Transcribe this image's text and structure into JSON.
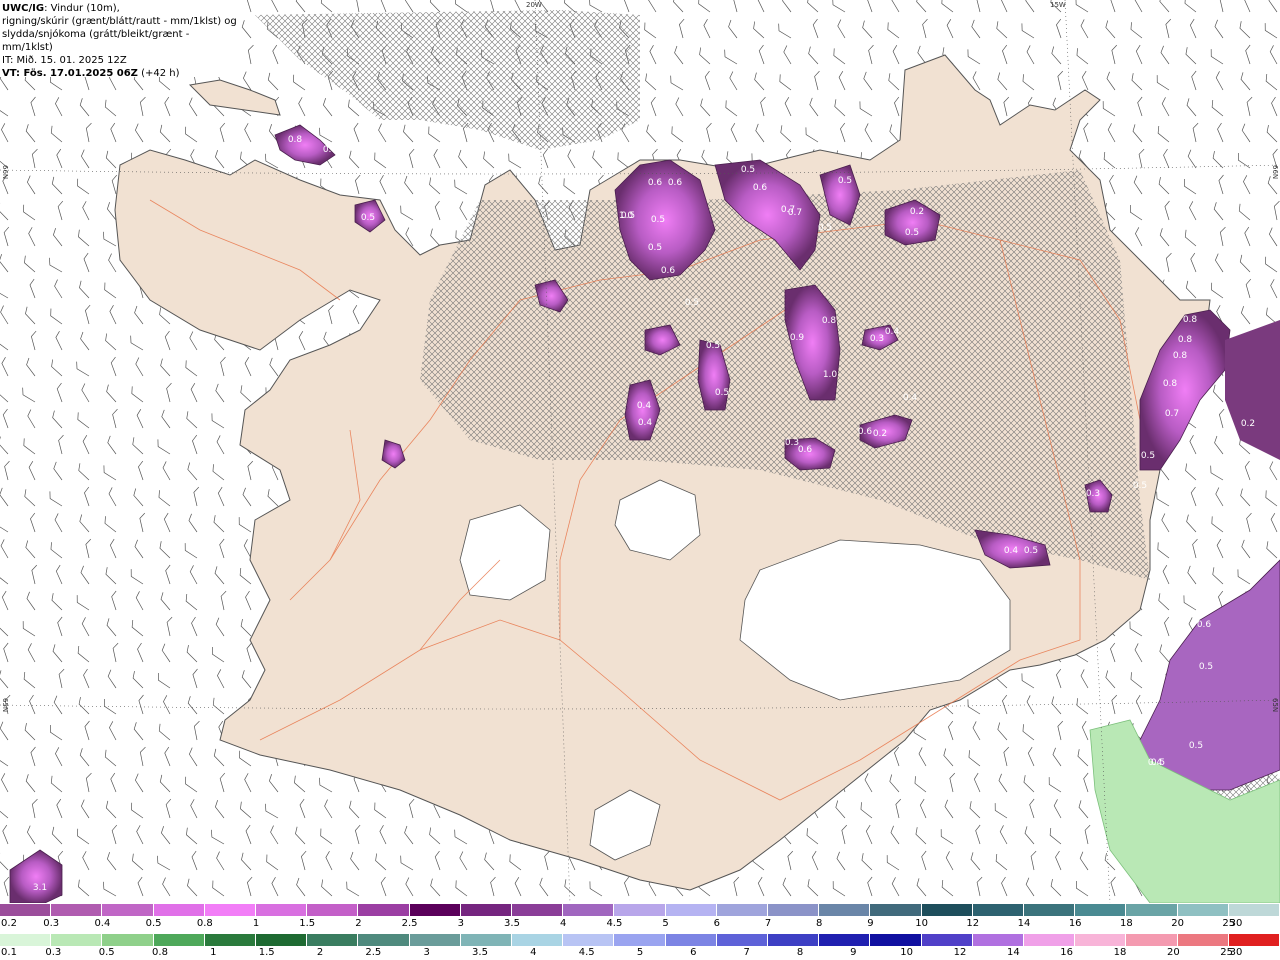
{
  "header": {
    "line1_bold": "UWC/IG",
    "line1_rest": ": Vindur (10m),",
    "line2": "rigning/skúrir (grænt/blátt/rautt - mm/1klst) og",
    "line3": "slydda/snjókoma (grátt/bleikt/grænt - mm/1klst)",
    "line4": "IT: Mið. 15. 01. 2025 12Z",
    "line5_bold": "VT: Fös. 17.01.2025 06Z",
    "line5_rest": " (+42 h)"
  },
  "grid_labels": {
    "lon_20w": "20W",
    "lon_15w": "15W",
    "lat_66n_left": "66N",
    "lat_65n_left": "65N",
    "lat_66n_right": "66N",
    "lat_65n_right": "65N"
  },
  "precip_values": [
    "0.4",
    "0.7",
    "0.8",
    "0.4",
    "0.5",
    "0.6",
    "0.6",
    "0.5",
    "0.5",
    "0.5",
    "0.5",
    "0.6",
    "0.7",
    "0.7",
    "0.5",
    "0.5",
    "1.0",
    "0.5",
    "0.6",
    "0.4",
    "0.4",
    "0.5",
    "0.5",
    "0.8",
    "1.0",
    "0.9",
    "0.3",
    "0.4",
    "0.3",
    "0.6",
    "0.6",
    "0.2",
    "0.4",
    "0.2",
    "0.5",
    "0.8",
    "0.8",
    "0.8",
    "0.7",
    "0.8",
    "0.5",
    "0.2",
    "0.5",
    "0.3",
    "0.4",
    "0.5",
    "0.5",
    "0.6",
    "0.5",
    "0.5",
    "0.4",
    "3.1"
  ],
  "legend": {
    "snow_labels": [
      "0.2",
      "0.3",
      "0.4",
      "0.5",
      "0.8",
      "1",
      "1.5",
      "2",
      "2.5",
      "3",
      "3.5",
      "4",
      "4.5",
      "5",
      "6",
      "7",
      "8",
      "9",
      "10",
      "12",
      "14",
      "16",
      "18",
      "20",
      "25",
      "30"
    ],
    "rain_labels": [
      "0.1",
      "0.3",
      "0.5",
      "0.8",
      "1",
      "1.5",
      "2",
      "2.5",
      "3",
      "3.5",
      "4",
      "4.5",
      "5",
      "6",
      "7",
      "8",
      "9",
      "10",
      "12",
      "14",
      "16",
      "18",
      "20",
      "25",
      "30"
    ],
    "snow_colors": [
      "#9b4d9b",
      "#b05cb0",
      "#c066c6",
      "#e070e8",
      "#f27ef7",
      "#d86fe0",
      "#c35fc8",
      "#9b3ea3",
      "#5a005a",
      "#75257f",
      "#8a3d98",
      "#a066bf",
      "#b8a6ea",
      "#b5b3f2",
      "#9fa4dc",
      "#8b93c8",
      "#6a86a8",
      "#416a7c",
      "#1e4e5c",
      "#2d6270",
      "#3b737c",
      "#4a8a92",
      "#6aa4a6",
      "#8fc0c2",
      "#bed8d8"
    ],
    "rain_colors": [
      "#d9f5d9",
      "#b9e8b5",
      "#8fd08a",
      "#4ea85a",
      "#2a7a3c",
      "#1e6a32",
      "#3a7d60",
      "#4f8a7e",
      "#6a9c9a",
      "#7fb4b6",
      "#a9d4e4",
      "#b8c4f4",
      "#9aa4f0",
      "#7c84e4",
      "#5e62d8",
      "#3d3fc4",
      "#2020b0",
      "#1010a0",
      "#5040c8",
      "#b070e0",
      "#f0a0e8",
      "#f8b4d8",
      "#f49ab0",
      "#ec7880",
      "#e02020"
    ]
  }
}
